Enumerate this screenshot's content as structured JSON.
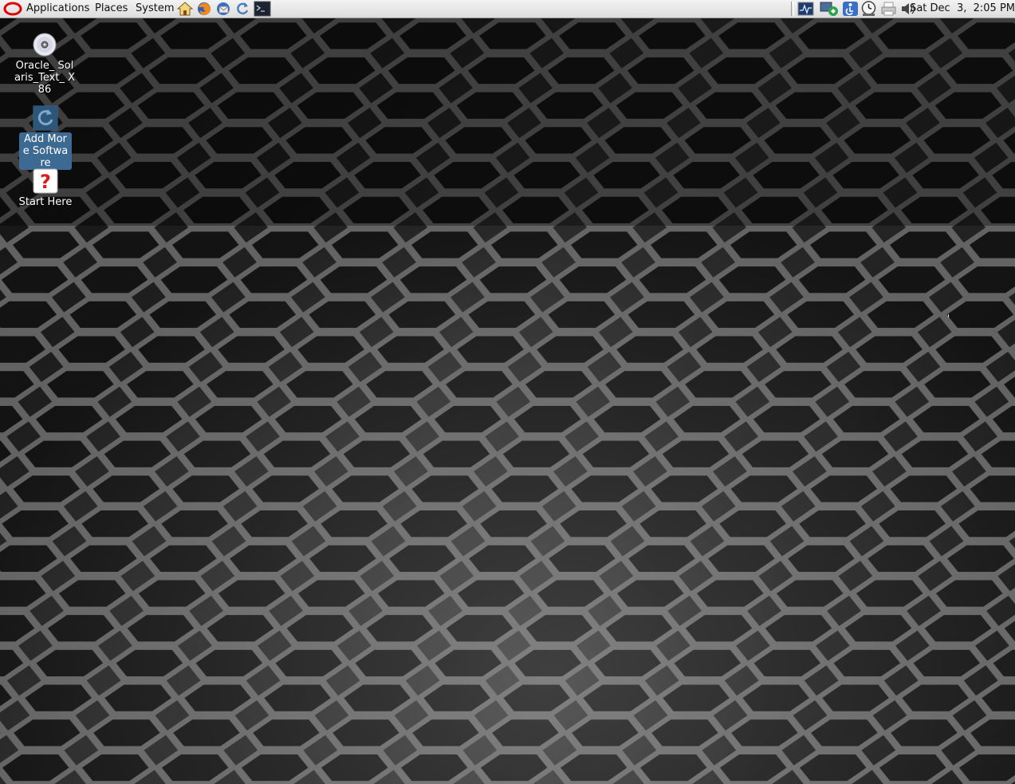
{
  "panel": {
    "menus": {
      "applications": "Applications",
      "places": "Places",
      "system": "System"
    },
    "launchers": [
      "home-icon",
      "firefox-icon",
      "thunderbird-icon",
      "update-manager-icon",
      "terminal-icon"
    ],
    "tray": [
      "system-monitor-icon",
      "network-icon",
      "accessibility-icon",
      "time-slider-icon",
      "printer-icon",
      "volume-icon"
    ],
    "clock": "Sat Dec  3,  2:05 PM"
  },
  "desktop": {
    "icons": [
      {
        "label": "Oracle_ Solaris_Text_ X86",
        "icon": "cd-disc-icon"
      },
      {
        "label": "Add More Software",
        "icon": "package-manager-icon",
        "selected": true
      },
      {
        "label": "Start Here",
        "icon": "help-icon"
      }
    ]
  },
  "colors": {
    "panel": "#dcdcdc",
    "selection": "#3d6a93",
    "oracle_red": "#e00000"
  }
}
